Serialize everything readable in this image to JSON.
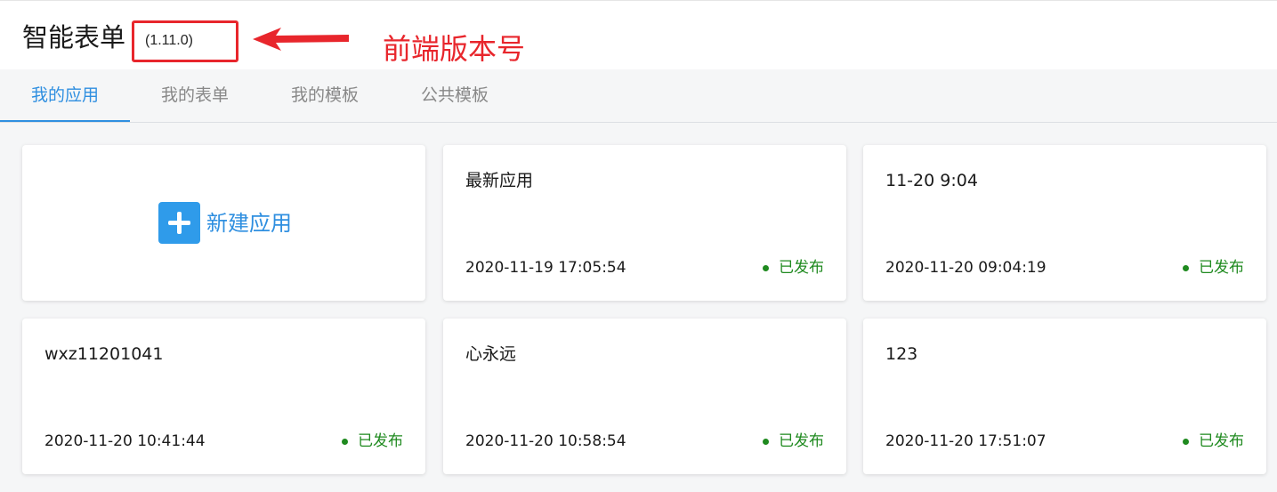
{
  "header": {
    "title": "智能表单",
    "version": "(1.11.0)",
    "annotation": "前端版本号"
  },
  "tabs": [
    {
      "label": "我的应用",
      "active": true
    },
    {
      "label": "我的表单",
      "active": false
    },
    {
      "label": "我的模板",
      "active": false
    },
    {
      "label": "公共模板",
      "active": false
    }
  ],
  "new_app": {
    "label": "新建应用",
    "icon": "plus-icon"
  },
  "apps": [
    {
      "name": "最新应用",
      "time": "2020-11-19 17:05:54",
      "status": "已发布"
    },
    {
      "name": "11-20 9:04",
      "time": "2020-11-20 09:04:19",
      "status": "已发布"
    },
    {
      "name": "wxz11201041",
      "time": "2020-11-20 10:41:44",
      "status": "已发布"
    },
    {
      "name": "心永远",
      "time": "2020-11-20 10:58:54",
      "status": "已发布"
    },
    {
      "name": "123",
      "time": "2020-11-20 17:51:07",
      "status": "已发布"
    }
  ],
  "colors": {
    "accent": "#2f8fe0",
    "published": "#1f8a1f",
    "annotation": "#e8262c"
  }
}
